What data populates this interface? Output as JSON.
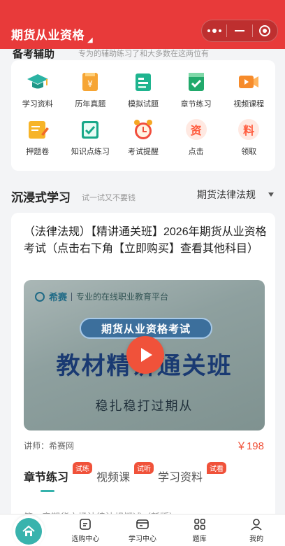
{
  "header": {
    "title": "期货从业资格",
    "accent": "#e83a3a"
  },
  "study_aid": {
    "peek_title": "备考辅助",
    "peek_sub": "专为的辅助练习了和大多数在这两位有",
    "items": [
      {
        "label": "学习资料",
        "icon": "graduation-cap-icon"
      },
      {
        "label": "历年真题",
        "icon": "exam-paper-icon"
      },
      {
        "label": "模拟试题",
        "icon": "test-sheet-icon"
      },
      {
        "label": "章节练习",
        "icon": "chapter-check-icon"
      },
      {
        "label": "视频课程",
        "icon": "video-camera-icon"
      },
      {
        "label": "押题卷",
        "icon": "pencil-note-icon"
      },
      {
        "label": "知识点练习",
        "icon": "book-check-icon"
      },
      {
        "label": "考试提醒",
        "icon": "alarm-clock-icon"
      },
      {
        "label": "点击",
        "icon": "资"
      },
      {
        "label": "领取",
        "icon": "料"
      }
    ]
  },
  "immersive": {
    "title": "沉浸式学习",
    "subtitle": "试一试又不要钱",
    "selector": "期货法律法规"
  },
  "course": {
    "title": "（法律法规）【精讲通关班】2026年期货从业资格考试（点击右下角【立即购买】查看其他科目）",
    "video": {
      "brand": "希赛",
      "tagline": "专业的在线职业教育平台",
      "pill": "期货从业资格考试",
      "headline": "教材精讲通关班",
      "slogan": "稳扎稳打过期从"
    },
    "teacher": "讲师：希赛网",
    "price": "￥198",
    "tabs": [
      {
        "label": "章节练习",
        "tag": "试练",
        "active": true
      },
      {
        "label": "视频课",
        "tag": "试听",
        "active": false
      },
      {
        "label": "学习资料",
        "tag": "试看",
        "active": false
      }
    ],
    "peek_row": "第一章期货市场法律法规概述（新版）"
  },
  "tabbar": {
    "items": [
      {
        "label": "",
        "icon": "home-icon"
      },
      {
        "label": "选购中心",
        "icon": "cart-box-icon"
      },
      {
        "label": "学习中心",
        "icon": "study-center-icon"
      },
      {
        "label": "题库",
        "icon": "grid-icon"
      },
      {
        "label": "我的",
        "icon": "user-icon"
      }
    ],
    "accent": "#39b3ad"
  }
}
